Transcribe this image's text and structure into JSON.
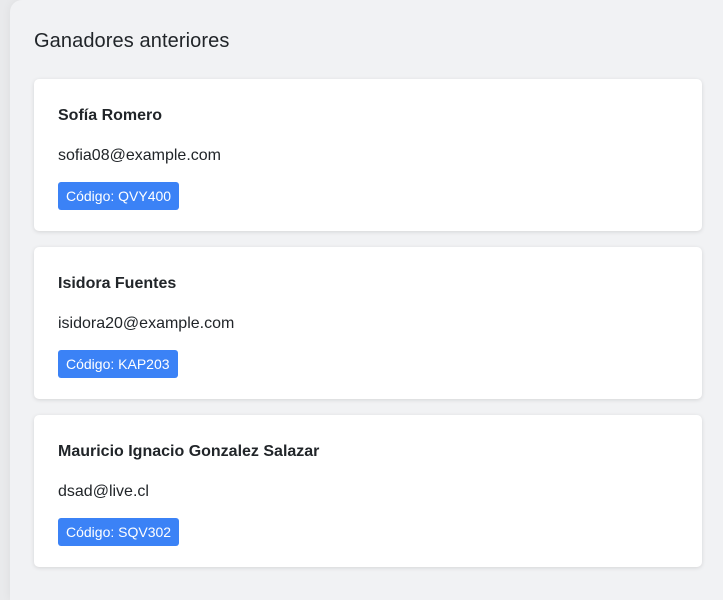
{
  "header": {
    "title": "Ganadores anteriores"
  },
  "winners": [
    {
      "name": "Sofía Romero",
      "email": "sofia08@example.com",
      "code": "Código: QVY400"
    },
    {
      "name": "Isidora Fuentes",
      "email": "isidora20@example.com",
      "code": "Código: KAP203"
    },
    {
      "name": "Mauricio Ignacio Gonzalez Salazar",
      "email": "dsad@live.cl",
      "code": "Código: SQV302"
    }
  ],
  "colors": {
    "badge": "#3b82f6",
    "card": "#ffffff",
    "panel": "#f1f2f4"
  }
}
